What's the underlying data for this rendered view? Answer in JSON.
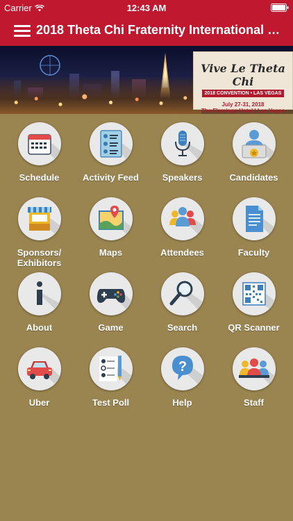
{
  "status_bar": {
    "carrier": "Carrier",
    "time": "12:43 AM"
  },
  "nav": {
    "title": "2018 Theta Chi Fraternity International Co..."
  },
  "banner": {
    "logo_script": "Vive Le Theta Chi",
    "logo_ribbon": "2018 CONVENTION • LAS VEGAS",
    "logo_dates": "July 27-31, 2018",
    "logo_venue": "The Flamingo Hotel | Las Vegas"
  },
  "menu": {
    "items": [
      {
        "label": "Schedule",
        "icon": "calendar-icon"
      },
      {
        "label": "Activity Feed",
        "icon": "activity-feed-icon"
      },
      {
        "label": "Speakers",
        "icon": "microphone-icon"
      },
      {
        "label": "Candidates",
        "icon": "candidate-badge-icon"
      },
      {
        "label": "Sponsors/ Exhibitors",
        "icon": "booth-icon"
      },
      {
        "label": "Maps",
        "icon": "map-icon"
      },
      {
        "label": "Attendees",
        "icon": "people-group-icon"
      },
      {
        "label": "Faculty",
        "icon": "document-icon"
      },
      {
        "label": "About",
        "icon": "info-icon"
      },
      {
        "label": "Game",
        "icon": "gamepad-icon"
      },
      {
        "label": "Search",
        "icon": "magnifier-icon"
      },
      {
        "label": "QR Scanner",
        "icon": "qr-code-icon"
      },
      {
        "label": "Uber",
        "icon": "car-icon"
      },
      {
        "label": "Test Poll",
        "icon": "poll-icon"
      },
      {
        "label": "Help",
        "icon": "help-bubble-icon"
      },
      {
        "label": "Staff",
        "icon": "staff-group-icon"
      }
    ]
  }
}
